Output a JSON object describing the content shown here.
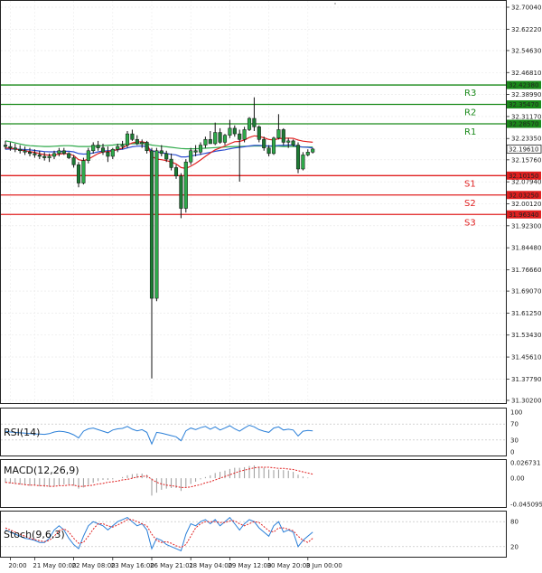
{
  "chart_data": {
    "type": "candlestick",
    "instrument_panel": {
      "y_ticks": [
        "32.70040",
        "32.62220",
        "32.54630",
        "32.46810",
        "32.38990",
        "32.31170",
        "32.23350",
        "32.15760",
        "32.07940",
        "32.00120",
        "31.92300",
        "31.84480",
        "31.76660",
        "31.69070",
        "31.61250",
        "31.53430",
        "31.45610",
        "31.37790",
        "31.30200"
      ],
      "ylim": [
        31.302,
        32.7004
      ],
      "current_price": "32.19610",
      "levels": [
        {
          "name": "R3",
          "value": 32.4238,
          "label": "32.42380",
          "color": "#1a8a1a"
        },
        {
          "name": "R2",
          "value": 32.3547,
          "label": "32.35470",
          "color": "#1a8a1a"
        },
        {
          "name": "R1",
          "value": 32.2857,
          "label": "32.28570",
          "color": "#1a8a1a"
        },
        {
          "name": "S1",
          "value": 32.1015,
          "label": "32.10150",
          "color": "#e02020"
        },
        {
          "name": "S2",
          "value": 32.0325,
          "label": "32.03250",
          "color": "#e02020"
        },
        {
          "name": "S3",
          "value": 31.9634,
          "label": "31.96340",
          "color": "#e02020"
        }
      ],
      "candles": [
        [
          32.21,
          32.225,
          32.195,
          32.205
        ],
        [
          32.205,
          32.22,
          32.19,
          32.2
        ],
        [
          32.2,
          32.215,
          32.185,
          32.195
        ],
        [
          32.195,
          32.21,
          32.18,
          32.19
        ],
        [
          32.19,
          32.205,
          32.175,
          32.185
        ],
        [
          32.185,
          32.2,
          32.17,
          32.18
        ],
        [
          32.18,
          32.195,
          32.165,
          32.175
        ],
        [
          32.175,
          32.19,
          32.16,
          32.17
        ],
        [
          32.17,
          32.185,
          32.155,
          32.165
        ],
        [
          32.165,
          32.18,
          32.15,
          32.17
        ],
        [
          32.17,
          32.19,
          32.16,
          32.18
        ],
        [
          32.18,
          32.2,
          32.17,
          32.19
        ],
        [
          32.19,
          32.2,
          32.175,
          32.18
        ],
        [
          32.18,
          32.185,
          32.16,
          32.165
        ],
        [
          32.165,
          32.175,
          32.13,
          32.14
        ],
        [
          32.14,
          32.15,
          32.06,
          32.075
        ],
        [
          32.075,
          32.165,
          32.07,
          32.155
        ],
        [
          32.155,
          32.2,
          32.145,
          32.19
        ],
        [
          32.19,
          32.22,
          32.18,
          32.21
        ],
        [
          32.21,
          32.225,
          32.19,
          32.2
        ],
        [
          32.2,
          32.215,
          32.175,
          32.185
        ],
        [
          32.185,
          32.205,
          32.15,
          32.17
        ],
        [
          32.17,
          32.2,
          32.16,
          32.195
        ],
        [
          32.195,
          32.215,
          32.185,
          32.205
        ],
        [
          32.205,
          32.225,
          32.195,
          32.21
        ],
        [
          32.21,
          32.26,
          32.2,
          32.25
        ],
        [
          32.25,
          32.265,
          32.225,
          32.23
        ],
        [
          32.23,
          32.245,
          32.21,
          32.215
        ],
        [
          32.215,
          32.23,
          32.2,
          32.22
        ],
        [
          32.22,
          32.225,
          32.18,
          32.19
        ],
        [
          32.19,
          32.2,
          31.38,
          31.665
        ],
        [
          31.665,
          32.2,
          31.655,
          32.19
        ],
        [
          32.19,
          32.21,
          32.17,
          32.18
        ],
        [
          32.18,
          32.19,
          32.15,
          32.16
        ],
        [
          32.16,
          32.18,
          32.12,
          32.13
        ],
        [
          32.13,
          32.14,
          32.09,
          32.1
        ],
        [
          32.1,
          32.11,
          31.95,
          31.985
        ],
        [
          31.985,
          32.16,
          31.97,
          32.15
        ],
        [
          32.15,
          32.2,
          32.14,
          32.19
        ],
        [
          32.19,
          32.21,
          32.17,
          32.185
        ],
        [
          32.185,
          32.22,
          32.175,
          32.21
        ],
        [
          32.21,
          32.24,
          32.2,
          32.23
        ],
        [
          32.23,
          32.26,
          32.22,
          32.215
        ],
        [
          32.215,
          32.29,
          32.21,
          32.255
        ],
        [
          32.255,
          32.27,
          32.215,
          32.22
        ],
        [
          32.22,
          32.25,
          32.21,
          32.245
        ],
        [
          32.245,
          32.3,
          32.235,
          32.27
        ],
        [
          32.27,
          32.28,
          32.24,
          32.25
        ],
        [
          32.25,
          32.265,
          32.08,
          32.23
        ],
        [
          32.23,
          32.275,
          32.22,
          32.265
        ],
        [
          32.265,
          32.31,
          32.26,
          32.305
        ],
        [
          32.305,
          32.38,
          32.26,
          32.275
        ],
        [
          32.275,
          32.28,
          32.22,
          32.23
        ],
        [
          32.23,
          32.24,
          32.19,
          32.2
        ],
        [
          32.2,
          32.21,
          32.17,
          32.18
        ],
        [
          32.18,
          32.24,
          32.175,
          32.235
        ],
        [
          32.235,
          32.32,
          32.23,
          32.265
        ],
        [
          32.265,
          32.27,
          32.21,
          32.22
        ],
        [
          32.22,
          32.235,
          32.2,
          32.225
        ],
        [
          32.225,
          32.23,
          32.205,
          32.21
        ],
        [
          32.21,
          32.22,
          32.11,
          32.125
        ],
        [
          32.125,
          32.185,
          32.12,
          32.175
        ],
        [
          32.175,
          32.195,
          32.17,
          32.185
        ],
        [
          32.185,
          32.2,
          32.18,
          32.196
        ]
      ],
      "ma_green": [
        32.225,
        32.222,
        32.218,
        32.214,
        32.21,
        32.208,
        32.207,
        32.206,
        32.205,
        32.205,
        32.206,
        32.207,
        32.208,
        32.208,
        32.207,
        32.205,
        32.205,
        32.205,
        32.206,
        32.207,
        32.208,
        32.209,
        32.21,
        32.212,
        32.213,
        32.214,
        32.215,
        32.215,
        32.215,
        32.214,
        32.21,
        32.208,
        32.206,
        32.204,
        32.202,
        32.2,
        32.198,
        32.197,
        32.197,
        32.197,
        32.198,
        32.199,
        32.2,
        32.201,
        32.202,
        32.203,
        32.204,
        32.205,
        32.205,
        32.206,
        32.206,
        32.207,
        32.207,
        32.207,
        32.206,
        32.206,
        32.206,
        32.205,
        32.205,
        32.205,
        32.204,
        32.203,
        32.203,
        32.203
      ],
      "ma_blue": [
        32.195,
        32.196,
        32.196,
        32.195,
        32.194,
        32.193,
        32.191,
        32.189,
        32.187,
        32.186,
        32.186,
        32.187,
        32.188,
        32.188,
        32.186,
        32.18,
        32.178,
        32.179,
        32.182,
        32.186,
        32.189,
        32.19,
        32.191,
        32.193,
        32.195,
        32.2,
        32.204,
        32.206,
        32.207,
        32.205,
        32.19,
        32.186,
        32.183,
        32.18,
        32.177,
        32.175,
        32.168,
        32.168,
        32.171,
        32.174,
        32.177,
        32.181,
        32.184,
        32.188,
        32.191,
        32.193,
        32.197,
        32.2,
        32.202,
        32.204,
        32.207,
        32.209,
        32.209,
        32.208,
        32.207,
        32.207,
        32.209,
        32.209,
        32.21,
        32.21,
        32.205,
        32.203,
        32.202,
        32.2
      ],
      "ma_red": [
        32.2,
        32.199,
        32.196,
        32.193,
        32.19,
        32.187,
        32.184,
        32.18,
        32.176,
        32.174,
        32.175,
        32.178,
        32.18,
        32.179,
        32.173,
        32.158,
        32.155,
        32.16,
        32.17,
        32.18,
        32.186,
        32.187,
        32.19,
        32.194,
        32.199,
        32.21,
        32.218,
        32.221,
        32.222,
        32.218,
        32.17,
        32.16,
        32.158,
        32.155,
        32.15,
        32.143,
        32.13,
        32.127,
        32.135,
        32.145,
        32.157,
        32.17,
        32.182,
        32.193,
        32.2,
        32.207,
        32.215,
        32.222,
        32.223,
        32.228,
        32.237,
        32.243,
        32.241,
        32.236,
        32.23,
        32.228,
        32.233,
        32.234,
        32.235,
        32.234,
        32.228,
        32.224,
        32.222,
        32.22
      ]
    },
    "x_ticks": [
      {
        "label": "20:00",
        "at": 1
      },
      {
        "label": "21 May 00:00",
        "at": 6
      },
      {
        "label": "22 May 08:00",
        "at": 14
      },
      {
        "label": "23 May 16:00",
        "at": 22
      },
      {
        "label": "26 May 21:01",
        "at": 30
      },
      {
        "label": "28 May 04:00",
        "at": 38
      },
      {
        "label": "29 May 12:00",
        "at": 46
      },
      {
        "label": "30 May 20:00",
        "at": 54
      },
      {
        "label": "3 Jun 00:00",
        "at": 62
      }
    ],
    "rsi": {
      "name": "RSI(14)",
      "levels": [
        70,
        30
      ],
      "ticks": [
        "100",
        "70",
        "30",
        "0"
      ],
      "ylim": [
        0,
        100
      ],
      "values": [
        52,
        50,
        49,
        48,
        47,
        46,
        45,
        45,
        44,
        46,
        50,
        52,
        51,
        48,
        43,
        35,
        52,
        58,
        60,
        56,
        52,
        48,
        55,
        58,
        59,
        64,
        57,
        53,
        56,
        49,
        20,
        49,
        47,
        44,
        41,
        38,
        28,
        53,
        60,
        56,
        61,
        64,
        57,
        63,
        55,
        60,
        66,
        58,
        52,
        60,
        67,
        63,
        56,
        52,
        49,
        60,
        63,
        55,
        57,
        55,
        40,
        52,
        54,
        53
      ]
    },
    "macd": {
      "name": "MACD(12,26,9)",
      "ticks": [
        "0.026731",
        "0.00",
        "-0.045095"
      ],
      "ylim": [
        -0.045095,
        0.026731
      ],
      "histogram": [
        -0.008,
        -0.009,
        -0.01,
        -0.011,
        -0.012,
        -0.013,
        -0.013,
        -0.014,
        -0.015,
        -0.015,
        -0.014,
        -0.012,
        -0.011,
        -0.011,
        -0.013,
        -0.018,
        -0.016,
        -0.012,
        -0.008,
        -0.005,
        -0.003,
        -0.003,
        -0.002,
        0.0,
        0.002,
        0.005,
        0.007,
        0.008,
        0.008,
        0.006,
        -0.03,
        -0.025,
        -0.02,
        -0.018,
        -0.017,
        -0.017,
        -0.022,
        -0.015,
        -0.01,
        -0.006,
        -0.002,
        0.002,
        0.005,
        0.009,
        0.011,
        0.013,
        0.016,
        0.018,
        0.018,
        0.019,
        0.021,
        0.022,
        0.02,
        0.018,
        0.015,
        0.014,
        0.015,
        0.014,
        0.013,
        0.011,
        0.006,
        0.003,
        0.001,
        0.0
      ],
      "signal": [
        -0.007,
        -0.008,
        -0.009,
        -0.01,
        -0.011,
        -0.012,
        -0.012,
        -0.013,
        -0.013,
        -0.014,
        -0.014,
        -0.013,
        -0.013,
        -0.012,
        -0.012,
        -0.014,
        -0.014,
        -0.013,
        -0.012,
        -0.01,
        -0.009,
        -0.007,
        -0.006,
        -0.005,
        -0.003,
        -0.002,
        0.0,
        0.002,
        0.003,
        0.004,
        -0.002,
        -0.007,
        -0.01,
        -0.012,
        -0.013,
        -0.014,
        -0.016,
        -0.016,
        -0.015,
        -0.013,
        -0.011,
        -0.008,
        -0.006,
        -0.003,
        0.0,
        0.003,
        0.006,
        0.009,
        0.012,
        0.014,
        0.016,
        0.018,
        0.019,
        0.019,
        0.019,
        0.018,
        0.017,
        0.017,
        0.016,
        0.015,
        0.013,
        0.011,
        0.009,
        0.007
      ]
    },
    "stoch": {
      "name": "Stoch(9,6,3)",
      "ticks": [
        "80",
        "20"
      ],
      "levels": [
        80,
        20
      ],
      "ylim": [
        0,
        100
      ],
      "main": [
        60,
        55,
        50,
        45,
        40,
        38,
        35,
        30,
        30,
        40,
        60,
        70,
        60,
        40,
        25,
        15,
        45,
        70,
        80,
        75,
        70,
        60,
        70,
        80,
        85,
        90,
        80,
        70,
        75,
        60,
        15,
        40,
        35,
        25,
        20,
        15,
        10,
        50,
        75,
        70,
        80,
        85,
        75,
        85,
        70,
        80,
        90,
        75,
        60,
        75,
        85,
        80,
        65,
        55,
        45,
        70,
        80,
        55,
        60,
        55,
        20,
        35,
        45,
        55
      ],
      "signal": [
        65,
        60,
        55,
        50,
        45,
        40,
        37,
        34,
        32,
        35,
        45,
        58,
        63,
        55,
        40,
        28,
        30,
        45,
        62,
        75,
        75,
        70,
        67,
        72,
        78,
        85,
        85,
        80,
        75,
        70,
        50,
        35,
        30,
        32,
        28,
        22,
        18,
        25,
        45,
        65,
        75,
        80,
        80,
        80,
        78,
        78,
        82,
        82,
        75,
        70,
        75,
        80,
        78,
        68,
        58,
        55,
        65,
        65,
        62,
        58,
        45,
        35,
        30,
        40
      ]
    }
  }
}
